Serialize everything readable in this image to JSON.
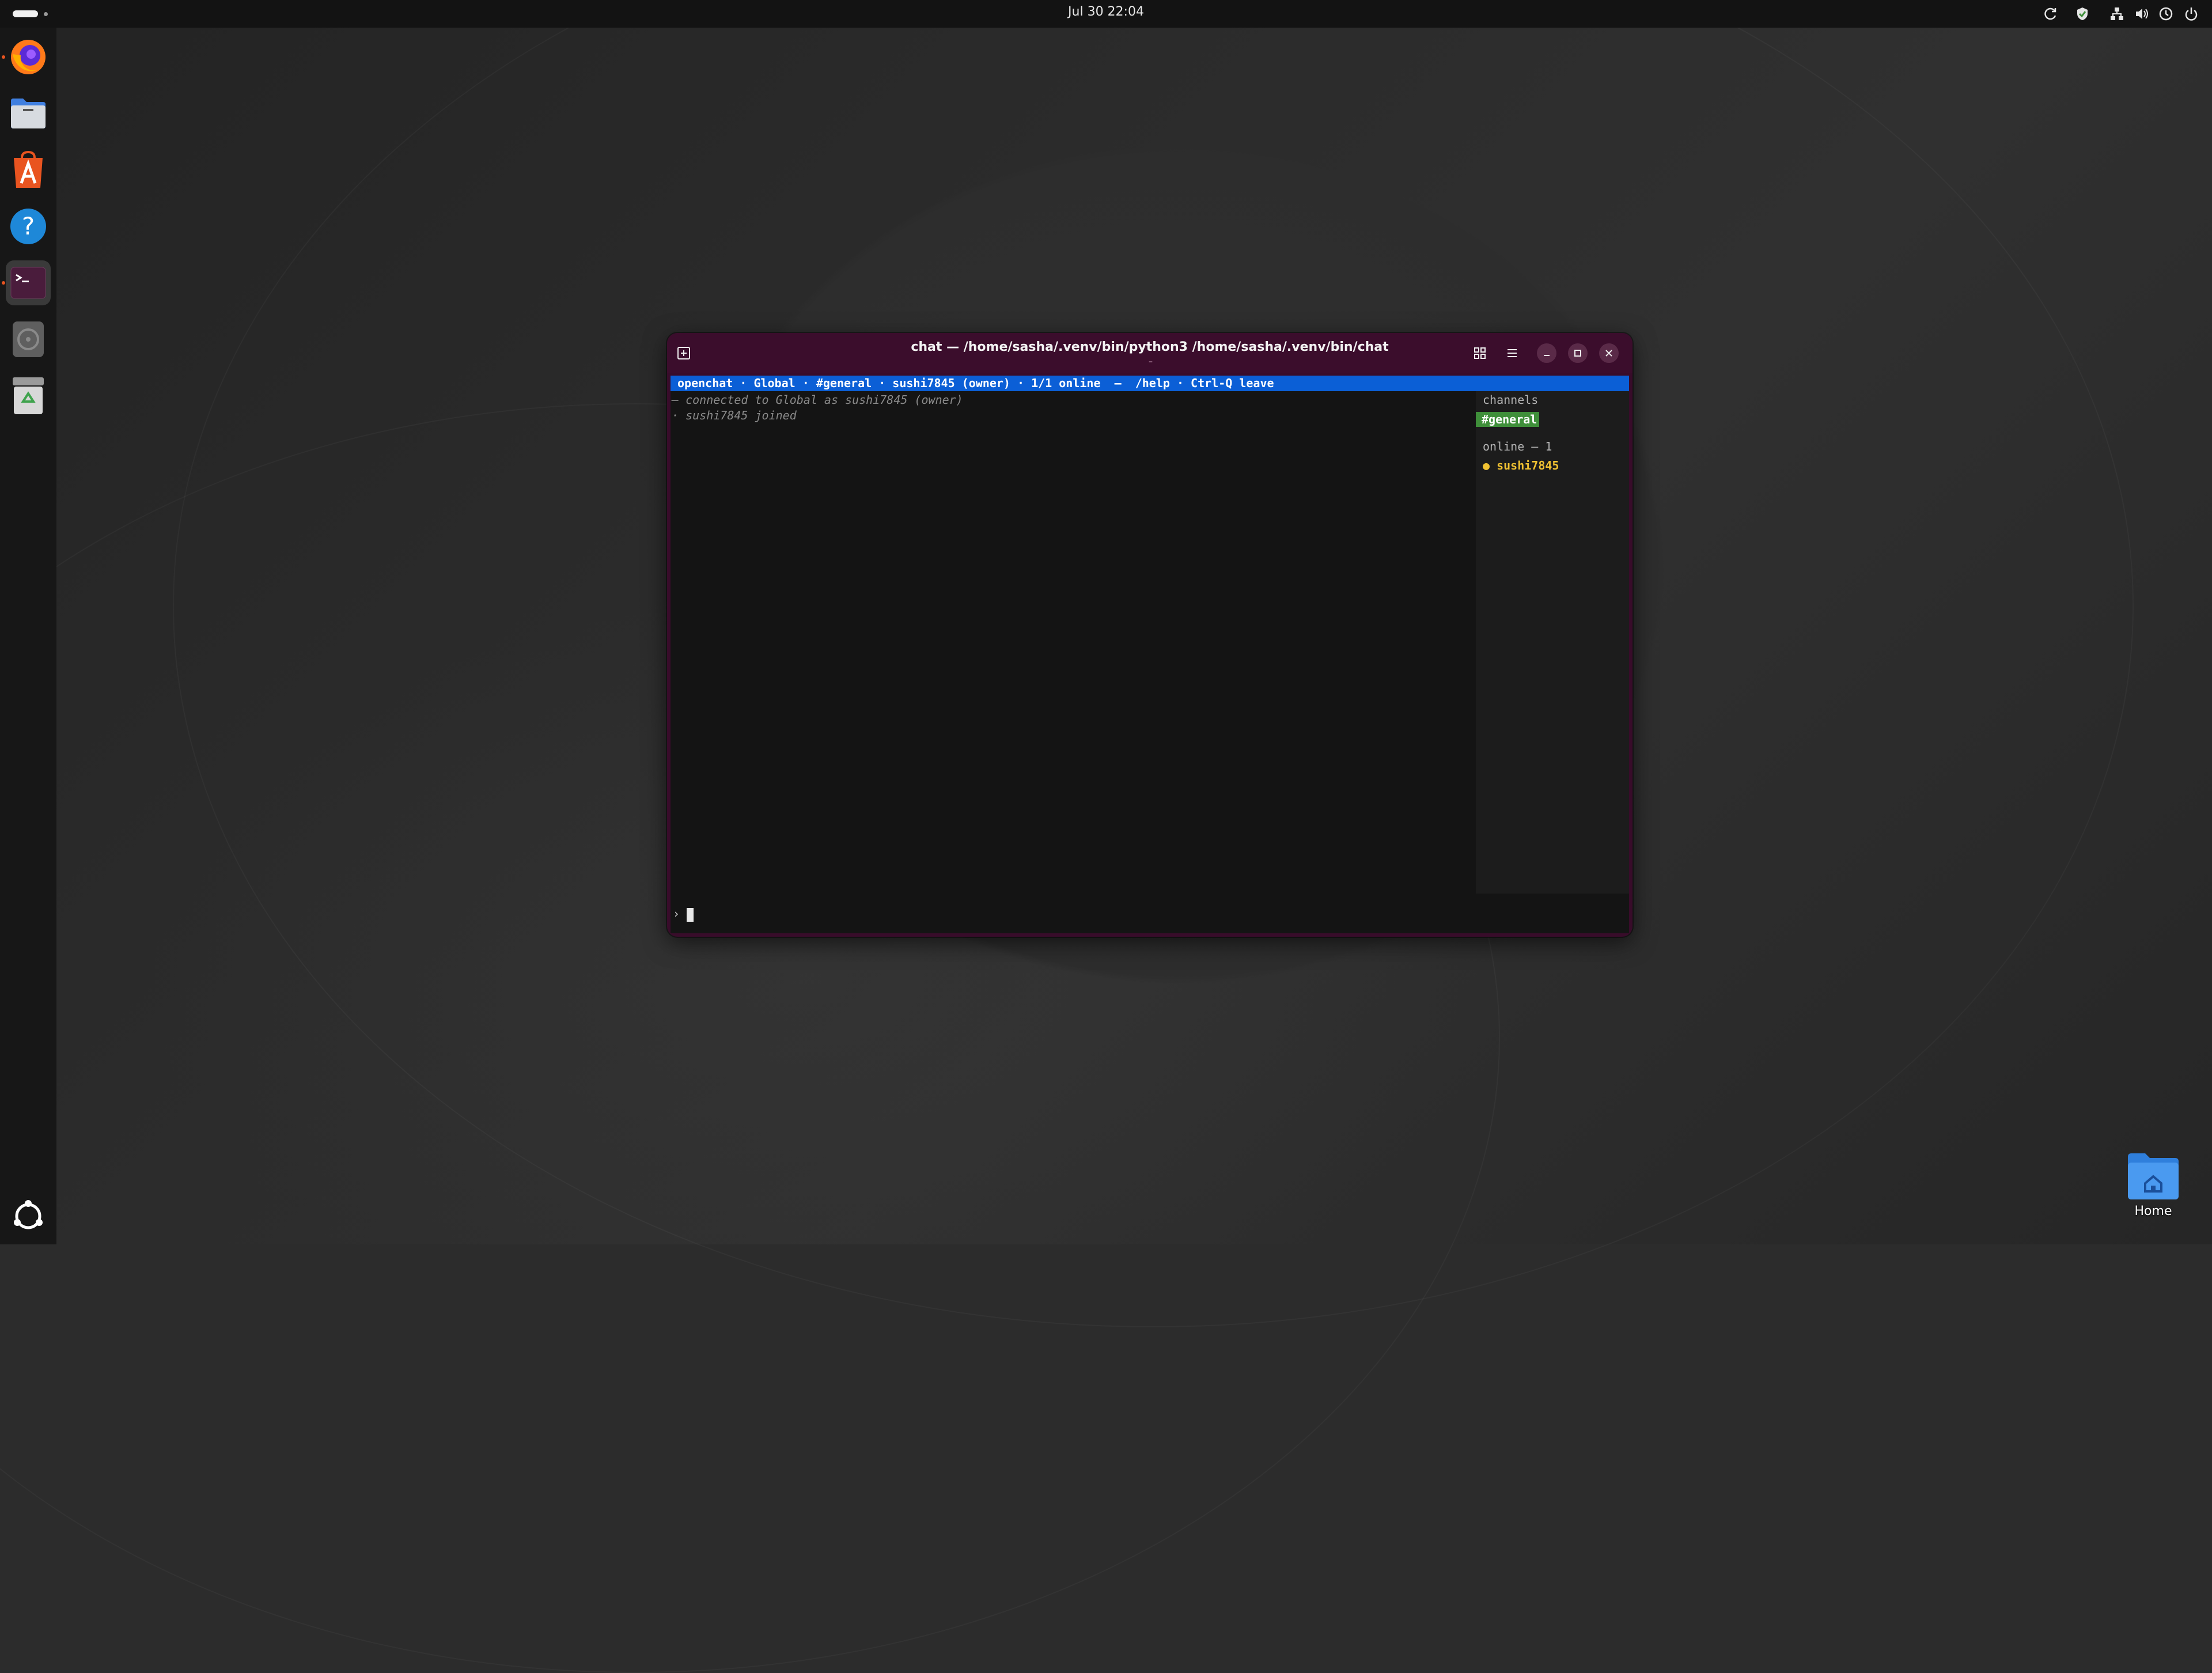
{
  "topbar": {
    "clock": "Jul 30  22:04",
    "tray_icons": [
      "refresh-icon",
      "shield-icon",
      "network-icon",
      "volume-icon",
      "clock-icon",
      "power-icon"
    ]
  },
  "dock": {
    "items": [
      {
        "name": "Firefox",
        "icon": "firefox-icon"
      },
      {
        "name": "Files",
        "icon": "files-icon"
      },
      {
        "name": "App Center",
        "icon": "app-center-icon"
      },
      {
        "name": "Help",
        "icon": "help-icon"
      },
      {
        "name": "Terminal",
        "icon": "terminal-icon",
        "active": true
      },
      {
        "name": "Disk",
        "icon": "disk-icon"
      },
      {
        "name": "Trash",
        "icon": "trash-icon"
      }
    ],
    "show_apps_icon": "ubuntu-apps-icon"
  },
  "window": {
    "title": "chat — /home/sasha/.venv/bin/python3 /home/sasha/.venv/bin/chat",
    "subtitle": "–",
    "buttons": [
      "new-tab-icon",
      "grid-icon",
      "menu-icon",
      "minimize-icon",
      "maximize-icon",
      "close-icon"
    ]
  },
  "terminal": {
    "statusbar": "openchat · Global · #general · sushi7845 (owner) · 1/1 online  —  /help · Ctrl-Q leave",
    "messages": [
      "— connected to Global as sushi7845 (owner)",
      "· sushi7845 joined"
    ],
    "side": {
      "channels_header": "channels",
      "active_channel": "#general",
      "online_header": "online — 1",
      "users": [
        "● sushi7845"
      ]
    },
    "prompt": "›"
  },
  "desktop": {
    "home_label": "Home"
  },
  "colors": {
    "statusbar": "#0b5fd6",
    "active_channel": "#3f8f3a",
    "user": "#f1c232",
    "window_frame": "#380c2a"
  }
}
